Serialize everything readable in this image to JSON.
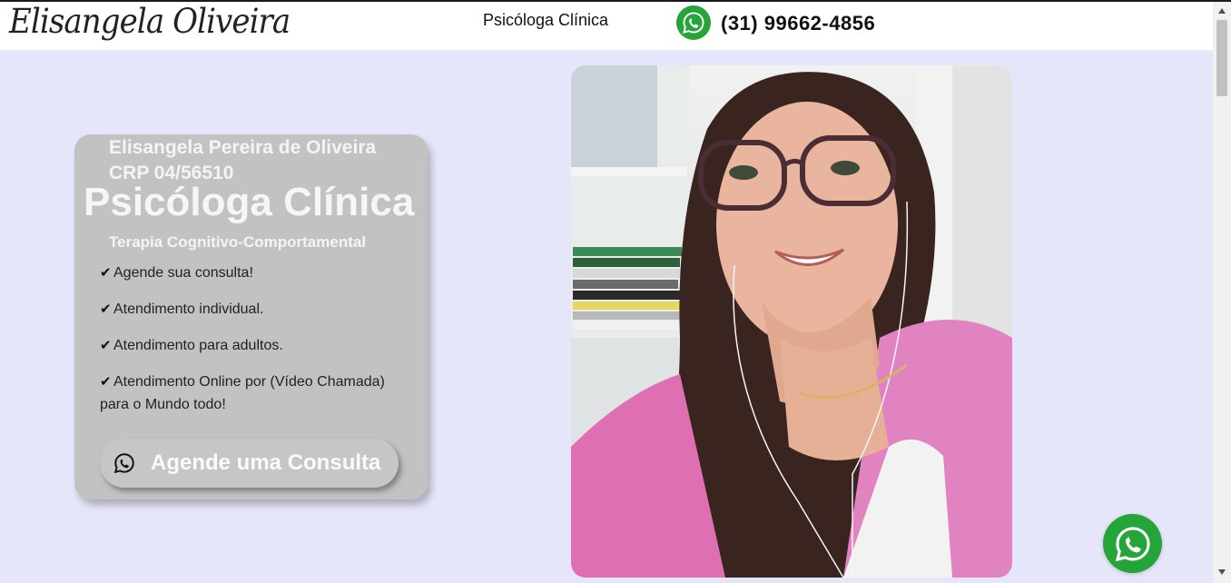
{
  "header": {
    "logo_text": "Elisangela Oliveira",
    "nav_title": "Psicóloga Clínica",
    "phone": "(31) 99662-4856",
    "whatsapp_icon": "whatsapp-icon"
  },
  "card": {
    "name": "Elisangela Pereira de Oliveira",
    "crp": "CRP 04/56510",
    "title": "Psicóloga Clínica",
    "subtitle": "Terapia Cognitivo-Comportamental",
    "items": [
      {
        "check": "✔",
        "text": "Agende sua consulta!"
      },
      {
        "check": "✔",
        "text": "Atendimento individual."
      },
      {
        "check": "✔",
        "text": "Atendimento para adultos."
      },
      {
        "check": "✔",
        "text": "Atendimento Online por (Vídeo Chamada) para o Mundo todo!"
      }
    ],
    "cta_label": "Agende uma Consulta",
    "cta_icon": "whatsapp-outline-icon"
  },
  "floating": {
    "icon": "whatsapp-icon"
  },
  "colors": {
    "background": "#e6e6fa",
    "card": "#c2c2c2",
    "whatsapp": "#25a43a"
  }
}
